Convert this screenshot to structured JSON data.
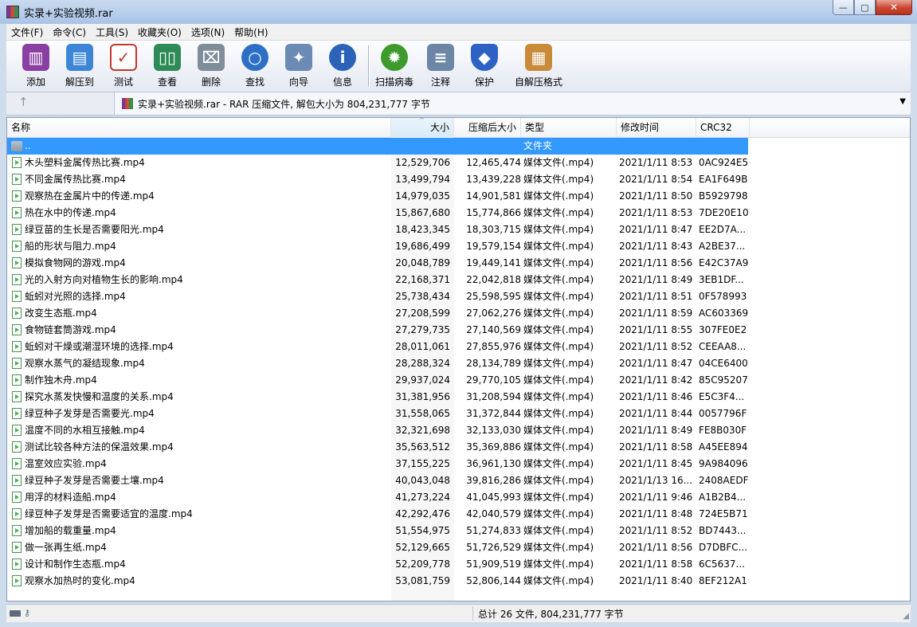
{
  "window": {
    "title": "实录+实验视频.rar",
    "minimize_label": "—",
    "maximize_label": "▢",
    "close_label": "✕"
  },
  "menu": [
    "文件(F)",
    "命令(C)",
    "工具(S)",
    "收藏夹(O)",
    "选项(N)",
    "帮助(H)"
  ],
  "toolbar": {
    "add": {
      "label": "添加",
      "icon": "archive-books-icon",
      "color": "#8a3fa3"
    },
    "extract": {
      "label": "解压到",
      "icon": "folder-extract-icon",
      "color": "#3d86d6"
    },
    "test": {
      "label": "测试",
      "icon": "checklist-icon",
      "color": "#c0392b"
    },
    "view": {
      "label": "查看",
      "icon": "open-book-icon",
      "color": "#2e8b57"
    },
    "delete": {
      "label": "删除",
      "icon": "trash-can-icon",
      "color": "#7f8c9a"
    },
    "find": {
      "label": "查找",
      "icon": "magnifier-icon",
      "color": "#2d6fc4"
    },
    "wizard": {
      "label": "向导",
      "icon": "magic-wand-icon",
      "color": "#6b8bb5"
    },
    "info": {
      "label": "信息",
      "icon": "info-icon",
      "color": "#2a63b8"
    },
    "virus_scan": {
      "label": "扫描病毒",
      "icon": "bug-scan-icon",
      "color": "#3f9a2e"
    },
    "comment": {
      "label": "注释",
      "icon": "comment-icon",
      "color": "#6d86a6"
    },
    "protect": {
      "label": "保护",
      "icon": "shield-icon",
      "color": "#2d62c4"
    },
    "sfx": {
      "label": "自解压格式",
      "icon": "sfx-box-icon",
      "color": "#c98a3a"
    }
  },
  "address": {
    "up_icon": "↑",
    "text": "实录+实验视频.rar - RAR 压缩文件, 解包大小为 804,231,777 字节",
    "dropdown_icon": "▼"
  },
  "columns": {
    "name": "名称",
    "size": "大小",
    "packed": "压缩后大小",
    "type": "类型",
    "modified": "修改时间",
    "crc": "CRC32",
    "sort_indicator": "^"
  },
  "parent_row": {
    "name": "..",
    "type": "文件夹"
  },
  "files": [
    {
      "name": "木头塑料金属传热比赛.mp4",
      "size": "12,529,706",
      "packed": "12,465,474",
      "type": "媒体文件(.mp4)",
      "modified": "2021/1/11 8:53",
      "crc": "0AC924E5"
    },
    {
      "name": "不同金属传热比赛.mp4",
      "size": "13,499,794",
      "packed": "13,439,228",
      "type": "媒体文件(.mp4)",
      "modified": "2021/1/11 8:54",
      "crc": "EA1F649B"
    },
    {
      "name": "观察热在金属片中的传递.mp4",
      "size": "14,979,035",
      "packed": "14,901,581",
      "type": "媒体文件(.mp4)",
      "modified": "2021/1/11 8:50",
      "crc": "B5929798"
    },
    {
      "name": "热在水中的传递.mp4",
      "size": "15,867,680",
      "packed": "15,774,866",
      "type": "媒体文件(.mp4)",
      "modified": "2021/1/11 8:53",
      "crc": "7DE20E10"
    },
    {
      "name": "绿豆苗的生长是否需要阳光.mp4",
      "size": "18,423,345",
      "packed": "18,303,715",
      "type": "媒体文件(.mp4)",
      "modified": "2021/1/11 8:47",
      "crc": "EE2D7A..."
    },
    {
      "name": "船的形状与阻力.mp4",
      "size": "19,686,499",
      "packed": "19,579,154",
      "type": "媒体文件(.mp4)",
      "modified": "2021/1/11 8:43",
      "crc": "A2BE37..."
    },
    {
      "name": "模拟食物网的游戏.mp4",
      "size": "20,048,789",
      "packed": "19,449,141",
      "type": "媒体文件(.mp4)",
      "modified": "2021/1/11 8:56",
      "crc": "E42C37A9"
    },
    {
      "name": "光的入射方向对植物生长的影响.mp4",
      "size": "22,168,371",
      "packed": "22,042,818",
      "type": "媒体文件(.mp4)",
      "modified": "2021/1/11 8:49",
      "crc": "3EB1DF..."
    },
    {
      "name": "蚯蚓对光照的选择.mp4",
      "size": "25,738,434",
      "packed": "25,598,595",
      "type": "媒体文件(.mp4)",
      "modified": "2021/1/11 8:51",
      "crc": "0F578993"
    },
    {
      "name": "改变生态瓶.mp4",
      "size": "27,208,599",
      "packed": "27,062,276",
      "type": "媒体文件(.mp4)",
      "modified": "2021/1/11 8:59",
      "crc": "AC603369"
    },
    {
      "name": "食物链套筒游戏.mp4",
      "size": "27,279,735",
      "packed": "27,140,569",
      "type": "媒体文件(.mp4)",
      "modified": "2021/1/11 8:55",
      "crc": "307FE0E2"
    },
    {
      "name": "蚯蚓对干燥或潮湿环境的选择.mp4",
      "size": "28,011,061",
      "packed": "27,855,976",
      "type": "媒体文件(.mp4)",
      "modified": "2021/1/11 8:52",
      "crc": "CEEAA8..."
    },
    {
      "name": "观察水蒸气的凝结现象.mp4",
      "size": "28,288,324",
      "packed": "28,134,789",
      "type": "媒体文件(.mp4)",
      "modified": "2021/1/11 8:47",
      "crc": "04CE6400"
    },
    {
      "name": "制作独木舟.mp4",
      "size": "29,937,024",
      "packed": "29,770,105",
      "type": "媒体文件(.mp4)",
      "modified": "2021/1/11 8:42",
      "crc": "85C95207"
    },
    {
      "name": "探究水蒸发快慢和温度的关系.mp4",
      "size": "31,381,956",
      "packed": "31,208,594",
      "type": "媒体文件(.mp4)",
      "modified": "2021/1/11 8:46",
      "crc": "E5C3F4..."
    },
    {
      "name": "绿豆种子发芽是否需要光.mp4",
      "size": "31,558,065",
      "packed": "31,372,844",
      "type": "媒体文件(.mp4)",
      "modified": "2021/1/11 8:44",
      "crc": "0057796F"
    },
    {
      "name": "温度不同的水相互接触.mp4",
      "size": "32,321,698",
      "packed": "32,133,030",
      "type": "媒体文件(.mp4)",
      "modified": "2021/1/11 8:49",
      "crc": "FE8B030F"
    },
    {
      "name": "测试比较各种方法的保温效果.mp4",
      "size": "35,563,512",
      "packed": "35,369,886",
      "type": "媒体文件(.mp4)",
      "modified": "2021/1/11 8:58",
      "crc": "A45EE894"
    },
    {
      "name": "温室效应实验.mp4",
      "size": "37,155,225",
      "packed": "36,961,130",
      "type": "媒体文件(.mp4)",
      "modified": "2021/1/11 8:45",
      "crc": "9A984096"
    },
    {
      "name": "绿豆种子发芽是否需要土壤.mp4",
      "size": "40,043,048",
      "packed": "39,816,286",
      "type": "媒体文件(.mp4)",
      "modified": "2021/1/13 16...",
      "crc": "2408AEDF"
    },
    {
      "name": "用浮的材料造船.mp4",
      "size": "41,273,224",
      "packed": "41,045,993",
      "type": "媒体文件(.mp4)",
      "modified": "2021/1/11 9:46",
      "crc": "A1B2B4..."
    },
    {
      "name": "绿豆种子发芽是否需要适宜的温度.mp4",
      "size": "42,292,476",
      "packed": "42,040,579",
      "type": "媒体文件(.mp4)",
      "modified": "2021/1/11 8:48",
      "crc": "724E5B71"
    },
    {
      "name": "增加船的载重量.mp4",
      "size": "51,554,975",
      "packed": "51,274,833",
      "type": "媒体文件(.mp4)",
      "modified": "2021/1/11 8:52",
      "crc": "BD7443..."
    },
    {
      "name": "做一张再生纸.mp4",
      "size": "52,129,665",
      "packed": "51,726,529",
      "type": "媒体文件(.mp4)",
      "modified": "2021/1/11 8:56",
      "crc": "D7DBFC..."
    },
    {
      "name": "设计和制作生态瓶.mp4",
      "size": "52,209,778",
      "packed": "51,909,519",
      "type": "媒体文件(.mp4)",
      "modified": "2021/1/11 8:58",
      "crc": "6C5637..."
    },
    {
      "name": "观察水加热时的变化.mp4",
      "size": "53,081,759",
      "packed": "52,806,144",
      "type": "媒体文件(.mp4)",
      "modified": "2021/1/11 8:40",
      "crc": "8EF212A1"
    }
  ],
  "status": {
    "text": "总计 26 文件, 804,231,777 字节",
    "key_icon": "⚷",
    "grip_icon": "◢"
  }
}
